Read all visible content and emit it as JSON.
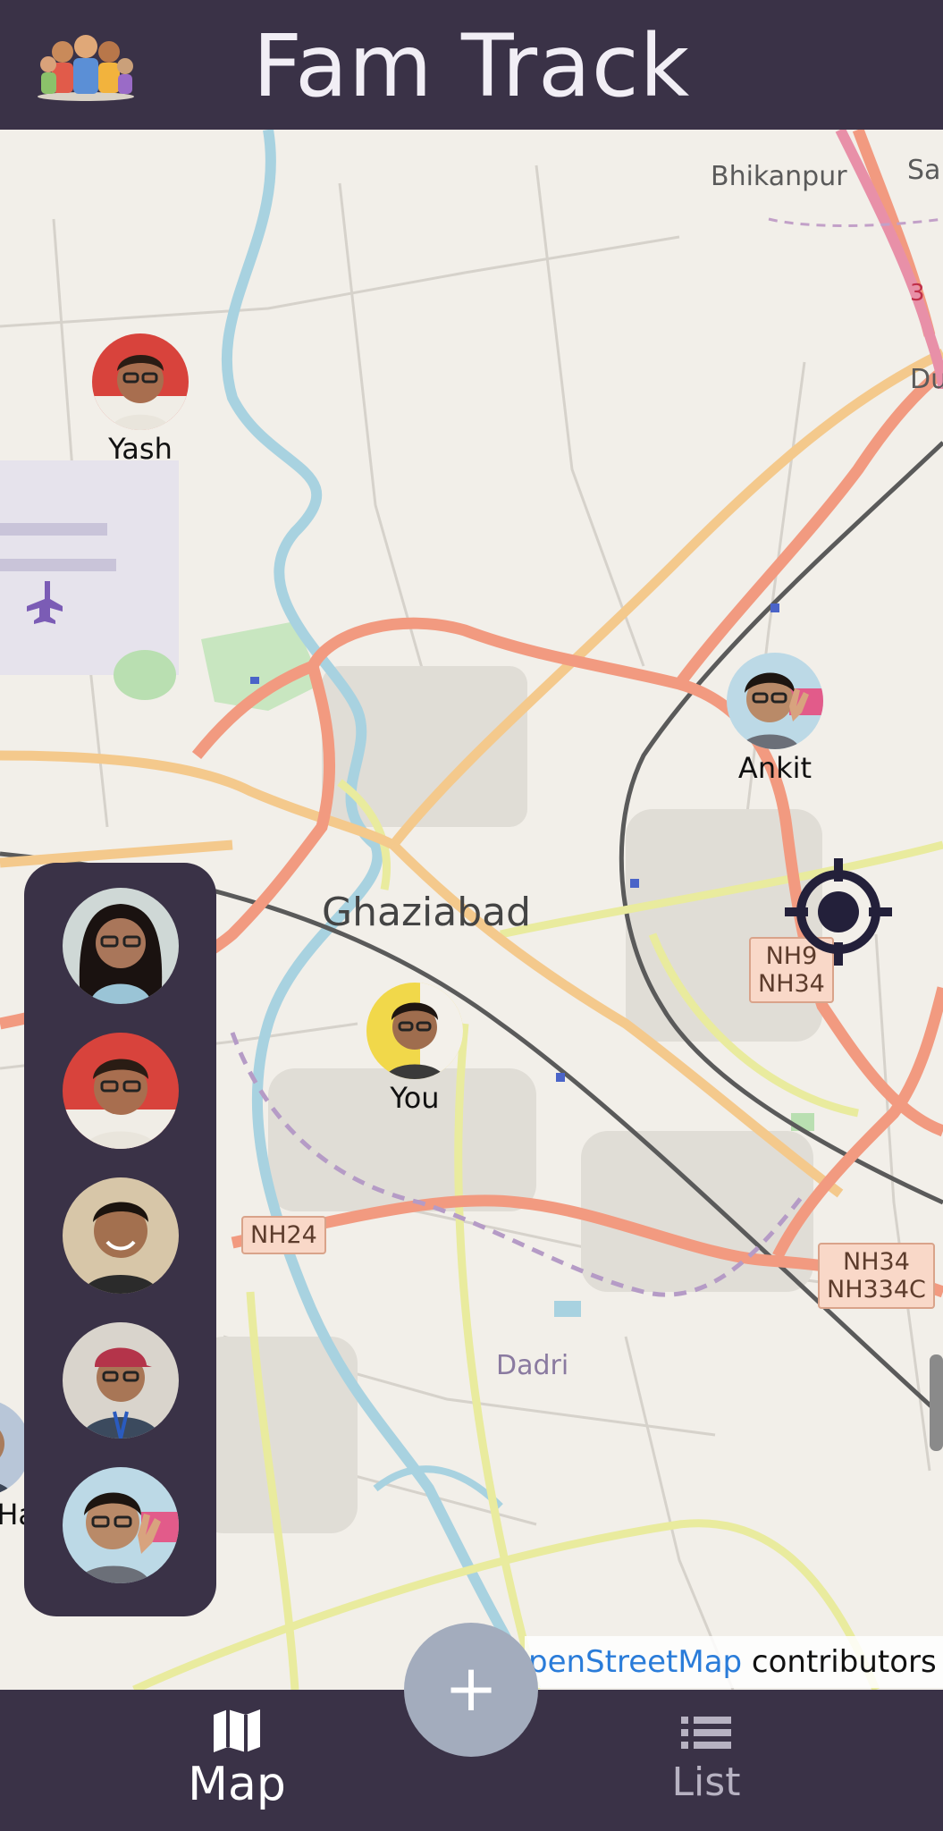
{
  "app": {
    "title": "Fam Track"
  },
  "map": {
    "places": {
      "ghaziabad": "Ghaziabad",
      "bhikanpur": "Bhikanpur",
      "dadri": "Dadri",
      "sar": "Sar",
      "du": "Du"
    },
    "shields": {
      "nh9_nh34_line1": "NH9",
      "nh9_nh34_line2": "NH34",
      "nh24": "NH24",
      "nh34_nh334c_line1": "NH34",
      "nh34_nh334c_line2": "NH334C",
      "ring_road": "3"
    },
    "attribution": {
      "link": "penStreetMap",
      "text": " contributors"
    }
  },
  "members": {
    "yash": {
      "name": "Yash"
    },
    "ankit": {
      "name": "Ankit"
    },
    "you": {
      "name": "You"
    },
    "partial": {
      "name": "Ha"
    }
  },
  "panel": {
    "avatar_icons": [
      "avatar-woman-glasses",
      "avatar-man-glasses-red",
      "avatar-man-smiling",
      "avatar-man-cap-lanyard",
      "avatar-man-peace-sign"
    ]
  },
  "bottom_nav": {
    "map_label": "Map",
    "list_label": "List",
    "add_label": "+"
  },
  "colors": {
    "bar": "#3a3247",
    "map_bg": "#f2efe9",
    "trunk_road": "#f29a80",
    "primary_road": "#f4c98c",
    "secondary_road": "#e9eb9e",
    "river": "#a8d2e0",
    "fab": "#a3acbd",
    "link": "#2a7cd9"
  }
}
